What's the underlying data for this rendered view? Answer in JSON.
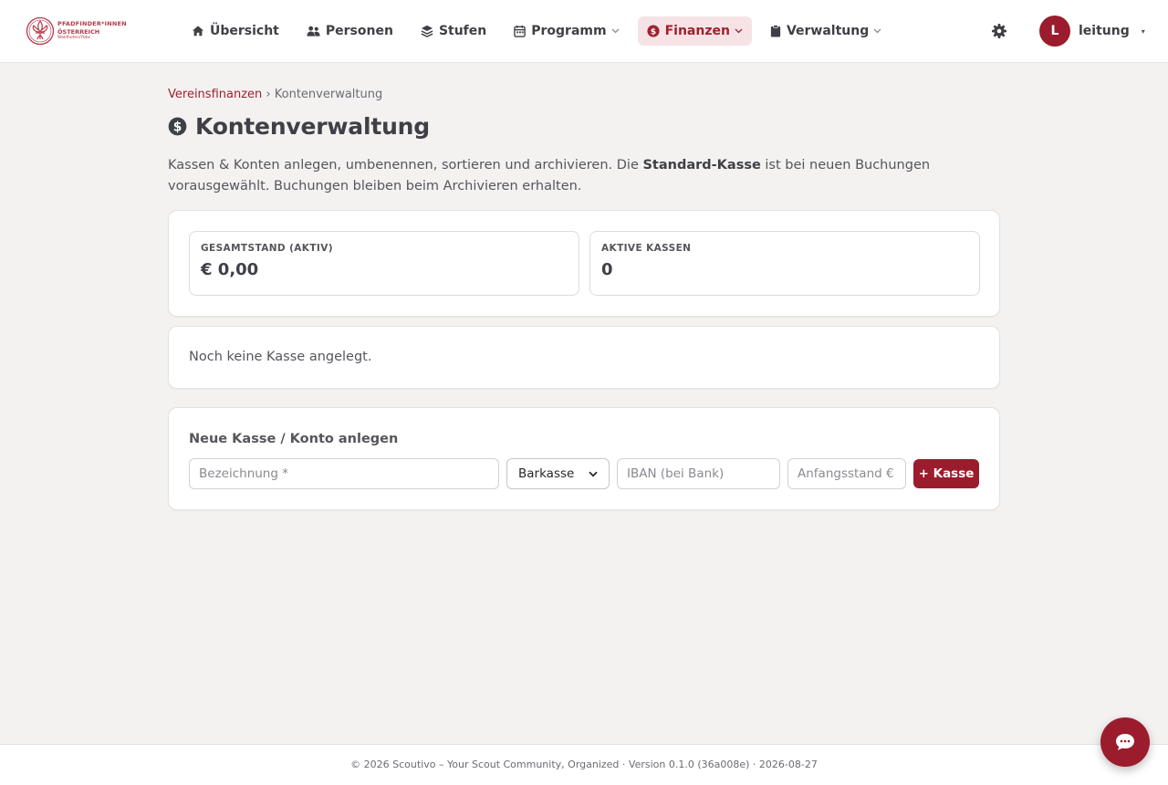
{
  "brand": {
    "logo_line1": "PFADFINDER*INNEN",
    "logo_line2": "ÖSTERREICH",
    "logo_line3": "Waldhofen/Ybbs",
    "accent_color": "#9b1c2c"
  },
  "nav": {
    "items": [
      {
        "label": "Übersicht",
        "icon": "home-icon"
      },
      {
        "label": "Personen",
        "icon": "people-icon"
      },
      {
        "label": "Stufen",
        "icon": "layers-icon"
      },
      {
        "label": "Programm",
        "icon": "calendar-icon",
        "has_dropdown": true
      },
      {
        "label": "Finanzen",
        "icon": "dollar-icon",
        "has_dropdown": true,
        "active": true
      },
      {
        "label": "Verwaltung",
        "icon": "clipboard-icon",
        "has_dropdown": true
      }
    ]
  },
  "user": {
    "initial": "L",
    "name": "leitung",
    "caret": "▾"
  },
  "breadcrumb": {
    "parent": "Vereinsfinanzen",
    "separator": "›",
    "current": "Kontenverwaltung"
  },
  "page": {
    "title": "Kontenverwaltung",
    "intro_before": "Kassen & Konten anlegen, umbenennen, sortieren und archivieren. Die ",
    "intro_bold": "Standard-Kasse",
    "intro_after": " ist bei neuen Buchungen vorausgewählt. Buchungen bleiben beim Archivieren erhalten."
  },
  "stats": {
    "total_label": "Gesamtstand (aktiv)",
    "total_value": "€ 0,00",
    "active_label": "Aktive Kassen",
    "active_value": "0"
  },
  "empty_state": "Noch keine Kasse angelegt.",
  "form": {
    "title": "Neue Kasse / Konto anlegen",
    "name_placeholder": "Bezeichnung *",
    "type_selected": "Barkasse",
    "iban_placeholder": "IBAN (bei Bank)",
    "balance_placeholder": "Anfangsstand €",
    "submit_label": "+ Kasse"
  },
  "footer": {
    "text": "© 2026 Scoutivo – Your Scout Community, Organized · Version 0.1.0 (36a008e) · 2026-08-27"
  }
}
